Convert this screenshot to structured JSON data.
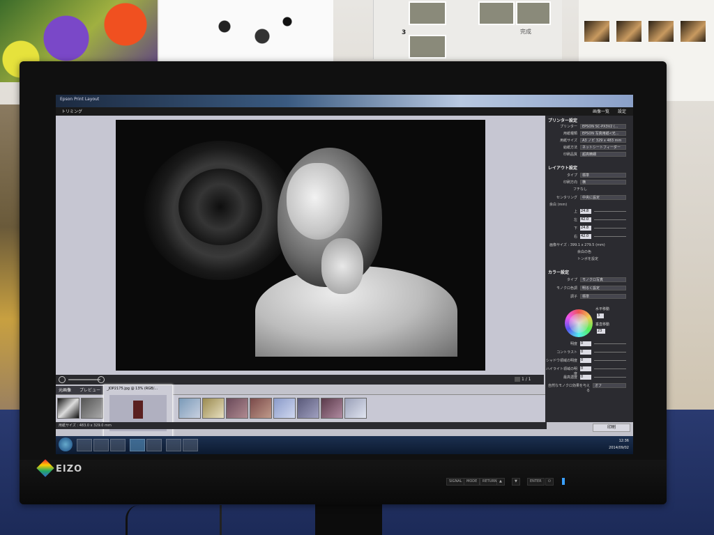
{
  "app": {
    "title": "Epson Print Layout",
    "menu": {
      "trimming": "トリミング",
      "image_list": "画像一覧",
      "settings": "設定"
    }
  },
  "monitor": {
    "brand": "EIZO",
    "buttons": [
      "SIGNAL",
      "MODE",
      "RETURN",
      "▲",
      "▼",
      "ENTER",
      "⏻"
    ]
  },
  "posters": {
    "steps_label": "完成",
    "step_number": "3"
  },
  "canvas": {
    "page_indicator": "1 / 1",
    "status_size": "用紙サイズ : 483.0 x 329.0 mm"
  },
  "thumbnails": {
    "tabs": [
      "元画像",
      "プレビュー"
    ],
    "tooltip_title": "_JOP2175.jpg @ 13% (RGB/..."
  },
  "panel": {
    "printer_section": "プリンター設定",
    "printer_rows": [
      {
        "label": "プリンター",
        "value": "EPSON SC-PX3V2 (..."
      },
      {
        "label": "用紙種類",
        "value": "EPSON 写真用紙<光..."
      },
      {
        "label": "用紙サイズ",
        "value": "A3 ノビ 329 x 483 mm"
      },
      {
        "label": "給紙方法",
        "value": "ネットシートフィーダー"
      },
      {
        "label": "印刷品質",
        "value": "超高精細"
      }
    ],
    "layout_section": "レイアウト設定",
    "layout_rows": [
      {
        "label": "タイプ",
        "value": "標準"
      },
      {
        "label": "印刷方向",
        "value": "横"
      }
    ],
    "borderless": "フチなし",
    "centering": {
      "label": "センタリング",
      "value": "中央に設定"
    },
    "margin_label": "余白 (mm)",
    "margins": [
      {
        "label": "上",
        "value": "24.8"
      },
      {
        "label": "左",
        "value": "42.0"
      },
      {
        "label": "下",
        "value": "24.8"
      },
      {
        "label": "右",
        "value": "42.0"
      }
    ],
    "image_size": "画像サイズ : 399.1 x 279.5 (mm)",
    "margin_color": "余白の色",
    "crop_mark": "トンボを設定",
    "color_section": "カラー設定",
    "color_rows": [
      {
        "label": "タイプ",
        "value": "モノクロ写真"
      },
      {
        "label": "モノクロ色調",
        "value": "明るく設定"
      },
      {
        "label": "調子",
        "value": "標準"
      }
    ],
    "horizontal_label": "水平移動",
    "horizontal_value": "3",
    "vertical_label": "垂直移動",
    "vertical_value": "23",
    "adjust_rows": [
      {
        "label": "明度",
        "value": "0"
      },
      {
        "label": "コントラスト",
        "value": "0"
      },
      {
        "label": "シャドウ領域の明度",
        "value": "0"
      },
      {
        "label": "ハイライト領域の明度",
        "value": "0"
      },
      {
        "label": "最高濃度",
        "value": "0"
      }
    ],
    "last_row": {
      "label": "自然なモノクロ効果を与える",
      "value": "オフ"
    },
    "print_button": "印刷"
  },
  "taskbar": {
    "time": "12:36",
    "date": "2014/09/02"
  },
  "colors": {
    "panel_bg": "#2b2b30",
    "canvas_bg": "#c6c6d2",
    "taskbar": "#0c1a30",
    "eizo_led": "#3aa0ff"
  }
}
